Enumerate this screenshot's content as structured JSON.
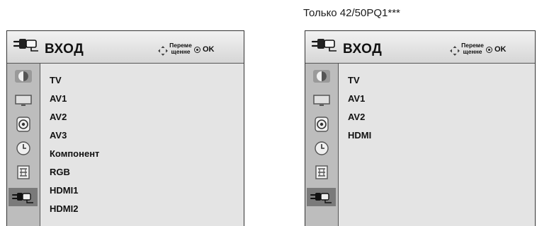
{
  "caption": "Только 42/50PQ1***",
  "menu": {
    "title": "ВХОД",
    "move_label": "Переме щенне",
    "ok_label": "OK"
  },
  "left_panel": {
    "items": [
      "TV",
      "AV1",
      "AV2",
      "AV3",
      "Компонент",
      "RGB",
      "HDMI1",
      "HDMI2"
    ]
  },
  "right_panel": {
    "items": [
      "TV",
      "AV1",
      "AV2",
      "HDMI"
    ]
  },
  "sidebar_icons": [
    "picture-icon",
    "screen-icon",
    "audio-icon",
    "time-icon",
    "option-icon",
    "input-icon"
  ],
  "colors": {
    "panel_bg": "#e4e4e4",
    "sidebar_bg": "#bdbdbd",
    "selected_tab": "#7a7a7a"
  }
}
